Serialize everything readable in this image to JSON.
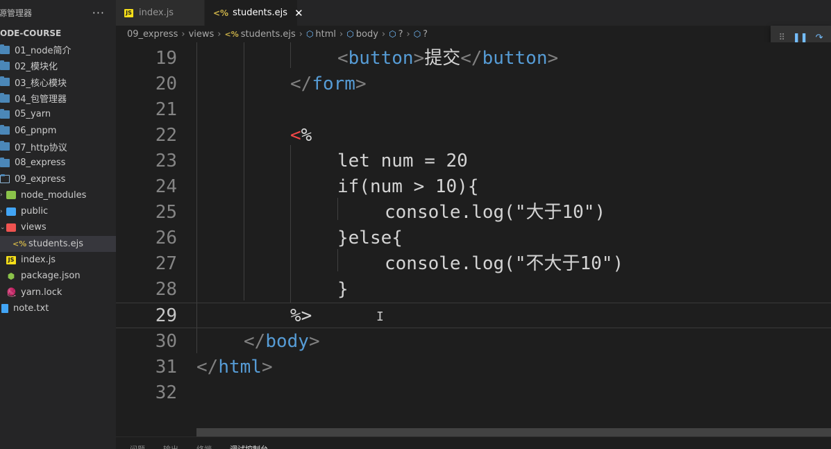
{
  "sidebar": {
    "title": "源管理器",
    "more_label": "···",
    "project": "ODE-COURSE",
    "items": [
      {
        "label": "01_node简介",
        "icon": "folder-icon"
      },
      {
        "label": "02_模块化",
        "icon": "folder-icon"
      },
      {
        "label": "03_核心模块",
        "icon": "folder-icon"
      },
      {
        "label": "04_包管理器",
        "icon": "folder-icon"
      },
      {
        "label": "05_yarn",
        "icon": "folder-icon"
      },
      {
        "label": "06_pnpm",
        "icon": "folder-icon"
      },
      {
        "label": "07_http协议",
        "icon": "folder-icon"
      },
      {
        "label": "08_express",
        "icon": "folder-icon"
      },
      {
        "label": "09_express",
        "icon": "folder-open-icon"
      },
      {
        "label": "node_modules",
        "icon": "node-modules-folder-icon"
      },
      {
        "label": "public",
        "icon": "public-folder-icon"
      },
      {
        "label": "views",
        "icon": "views-folder-icon"
      },
      {
        "label": "students.ejs",
        "icon": "ejs-file-icon"
      },
      {
        "label": "index.js",
        "icon": "js-file-icon"
      },
      {
        "label": "package.json",
        "icon": "json-file-icon"
      },
      {
        "label": "yarn.lock",
        "icon": "yarn-file-icon"
      },
      {
        "label": "note.txt",
        "icon": "txt-file-icon"
      }
    ]
  },
  "tabs": [
    {
      "label": "index.js",
      "badge": "JS",
      "active": false
    },
    {
      "label": "students.ejs",
      "badge": "<%",
      "active": true,
      "close": "✕"
    }
  ],
  "breadcrumb": {
    "folder": "09_express",
    "sub": "views",
    "file": "students.ejs",
    "ejs_icon": "<%",
    "html": "html",
    "body": "body",
    "q1": "?",
    "q2": "?"
  },
  "debug": {
    "grip": "⠿",
    "pause": "❚❚",
    "step": "↷"
  },
  "editor": {
    "lines": [
      {
        "num": "19",
        "parts": [
          "<",
          "button",
          ">",
          "提交",
          "</",
          "button",
          ">"
        ]
      },
      {
        "num": "20",
        "parts": [
          "</",
          "form",
          ">"
        ]
      },
      {
        "num": "21"
      },
      {
        "num": "22",
        "parts": [
          "<",
          "%"
        ]
      },
      {
        "num": "23",
        "text": "let num = 20"
      },
      {
        "num": "24",
        "text": "if(num > 10){"
      },
      {
        "num": "25",
        "text": "console.log(\"大于10\")"
      },
      {
        "num": "26",
        "text": "}else{"
      },
      {
        "num": "27",
        "text": "console.log(\"不大于10\")"
      },
      {
        "num": "28",
        "text": "}"
      },
      {
        "num": "29",
        "text": "%>"
      },
      {
        "num": "30",
        "parts": [
          "</",
          "body",
          ">"
        ]
      },
      {
        "num": "31",
        "parts": [
          "</",
          "html",
          ">"
        ]
      },
      {
        "num": "32"
      }
    ],
    "cursor_glyph": "I"
  },
  "panel": {
    "tabs": [
      "问题",
      "输出",
      "终端",
      "调试控制台"
    ],
    "active": "调试控制台"
  }
}
